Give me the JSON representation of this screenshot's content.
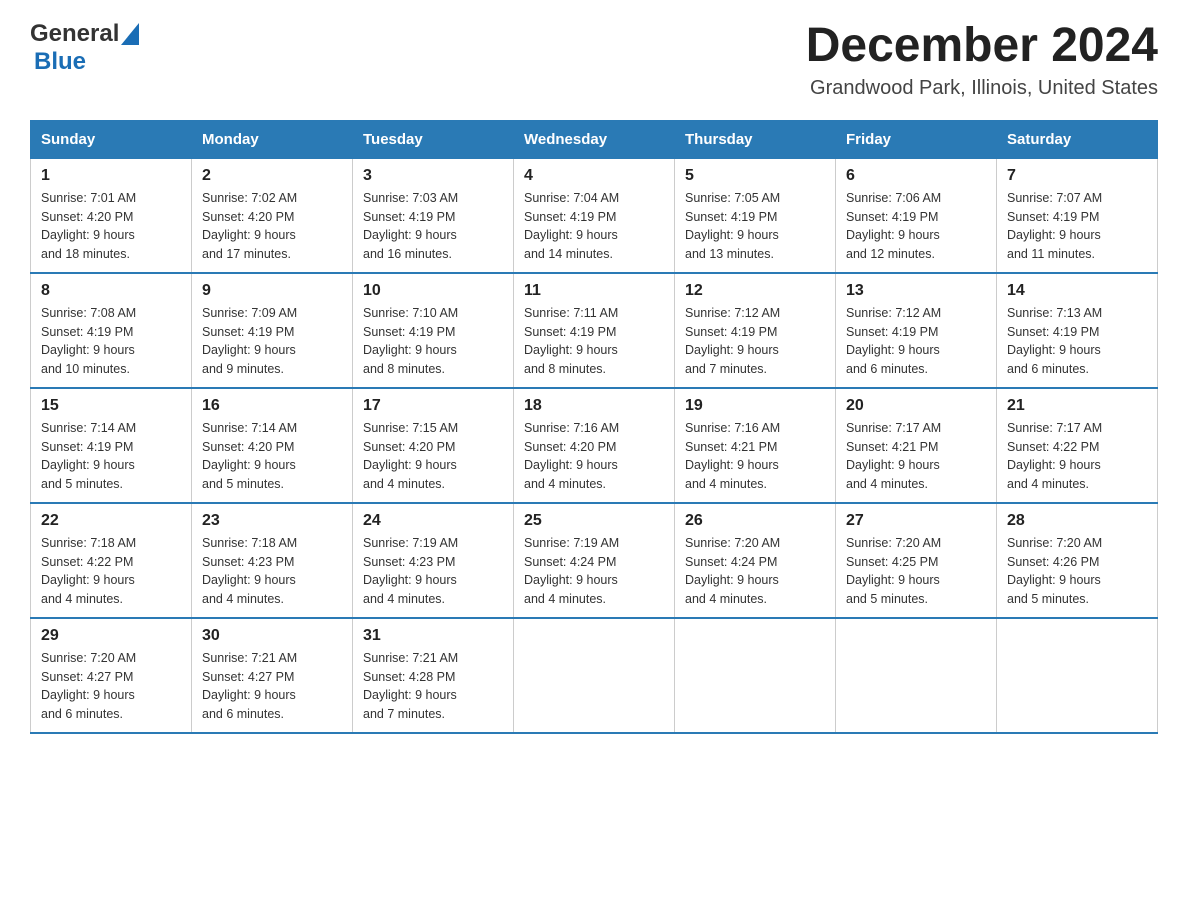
{
  "header": {
    "logo": {
      "general": "General",
      "blue": "Blue"
    },
    "title": "December 2024",
    "subtitle": "Grandwood Park, Illinois, United States"
  },
  "weekdays": [
    "Sunday",
    "Monday",
    "Tuesday",
    "Wednesday",
    "Thursday",
    "Friday",
    "Saturday"
  ],
  "weeks": [
    [
      {
        "day": "1",
        "sunrise": "7:01 AM",
        "sunset": "4:20 PM",
        "daylight": "9 hours and 18 minutes."
      },
      {
        "day": "2",
        "sunrise": "7:02 AM",
        "sunset": "4:20 PM",
        "daylight": "9 hours and 17 minutes."
      },
      {
        "day": "3",
        "sunrise": "7:03 AM",
        "sunset": "4:19 PM",
        "daylight": "9 hours and 16 minutes."
      },
      {
        "day": "4",
        "sunrise": "7:04 AM",
        "sunset": "4:19 PM",
        "daylight": "9 hours and 14 minutes."
      },
      {
        "day": "5",
        "sunrise": "7:05 AM",
        "sunset": "4:19 PM",
        "daylight": "9 hours and 13 minutes."
      },
      {
        "day": "6",
        "sunrise": "7:06 AM",
        "sunset": "4:19 PM",
        "daylight": "9 hours and 12 minutes."
      },
      {
        "day": "7",
        "sunrise": "7:07 AM",
        "sunset": "4:19 PM",
        "daylight": "9 hours and 11 minutes."
      }
    ],
    [
      {
        "day": "8",
        "sunrise": "7:08 AM",
        "sunset": "4:19 PM",
        "daylight": "9 hours and 10 minutes."
      },
      {
        "day": "9",
        "sunrise": "7:09 AM",
        "sunset": "4:19 PM",
        "daylight": "9 hours and 9 minutes."
      },
      {
        "day": "10",
        "sunrise": "7:10 AM",
        "sunset": "4:19 PM",
        "daylight": "9 hours and 8 minutes."
      },
      {
        "day": "11",
        "sunrise": "7:11 AM",
        "sunset": "4:19 PM",
        "daylight": "9 hours and 8 minutes."
      },
      {
        "day": "12",
        "sunrise": "7:12 AM",
        "sunset": "4:19 PM",
        "daylight": "9 hours and 7 minutes."
      },
      {
        "day": "13",
        "sunrise": "7:12 AM",
        "sunset": "4:19 PM",
        "daylight": "9 hours and 6 minutes."
      },
      {
        "day": "14",
        "sunrise": "7:13 AM",
        "sunset": "4:19 PM",
        "daylight": "9 hours and 6 minutes."
      }
    ],
    [
      {
        "day": "15",
        "sunrise": "7:14 AM",
        "sunset": "4:19 PM",
        "daylight": "9 hours and 5 minutes."
      },
      {
        "day": "16",
        "sunrise": "7:14 AM",
        "sunset": "4:20 PM",
        "daylight": "9 hours and 5 minutes."
      },
      {
        "day": "17",
        "sunrise": "7:15 AM",
        "sunset": "4:20 PM",
        "daylight": "9 hours and 4 minutes."
      },
      {
        "day": "18",
        "sunrise": "7:16 AM",
        "sunset": "4:20 PM",
        "daylight": "9 hours and 4 minutes."
      },
      {
        "day": "19",
        "sunrise": "7:16 AM",
        "sunset": "4:21 PM",
        "daylight": "9 hours and 4 minutes."
      },
      {
        "day": "20",
        "sunrise": "7:17 AM",
        "sunset": "4:21 PM",
        "daylight": "9 hours and 4 minutes."
      },
      {
        "day": "21",
        "sunrise": "7:17 AM",
        "sunset": "4:22 PM",
        "daylight": "9 hours and 4 minutes."
      }
    ],
    [
      {
        "day": "22",
        "sunrise": "7:18 AM",
        "sunset": "4:22 PM",
        "daylight": "9 hours and 4 minutes."
      },
      {
        "day": "23",
        "sunrise": "7:18 AM",
        "sunset": "4:23 PM",
        "daylight": "9 hours and 4 minutes."
      },
      {
        "day": "24",
        "sunrise": "7:19 AM",
        "sunset": "4:23 PM",
        "daylight": "9 hours and 4 minutes."
      },
      {
        "day": "25",
        "sunrise": "7:19 AM",
        "sunset": "4:24 PM",
        "daylight": "9 hours and 4 minutes."
      },
      {
        "day": "26",
        "sunrise": "7:20 AM",
        "sunset": "4:24 PM",
        "daylight": "9 hours and 4 minutes."
      },
      {
        "day": "27",
        "sunrise": "7:20 AM",
        "sunset": "4:25 PM",
        "daylight": "9 hours and 5 minutes."
      },
      {
        "day": "28",
        "sunrise": "7:20 AM",
        "sunset": "4:26 PM",
        "daylight": "9 hours and 5 minutes."
      }
    ],
    [
      {
        "day": "29",
        "sunrise": "7:20 AM",
        "sunset": "4:27 PM",
        "daylight": "9 hours and 6 minutes."
      },
      {
        "day": "30",
        "sunrise": "7:21 AM",
        "sunset": "4:27 PM",
        "daylight": "9 hours and 6 minutes."
      },
      {
        "day": "31",
        "sunrise": "7:21 AM",
        "sunset": "4:28 PM",
        "daylight": "9 hours and 7 minutes."
      },
      null,
      null,
      null,
      null
    ]
  ],
  "labels": {
    "sunrise": "Sunrise:",
    "sunset": "Sunset:",
    "daylight": "Daylight:"
  }
}
